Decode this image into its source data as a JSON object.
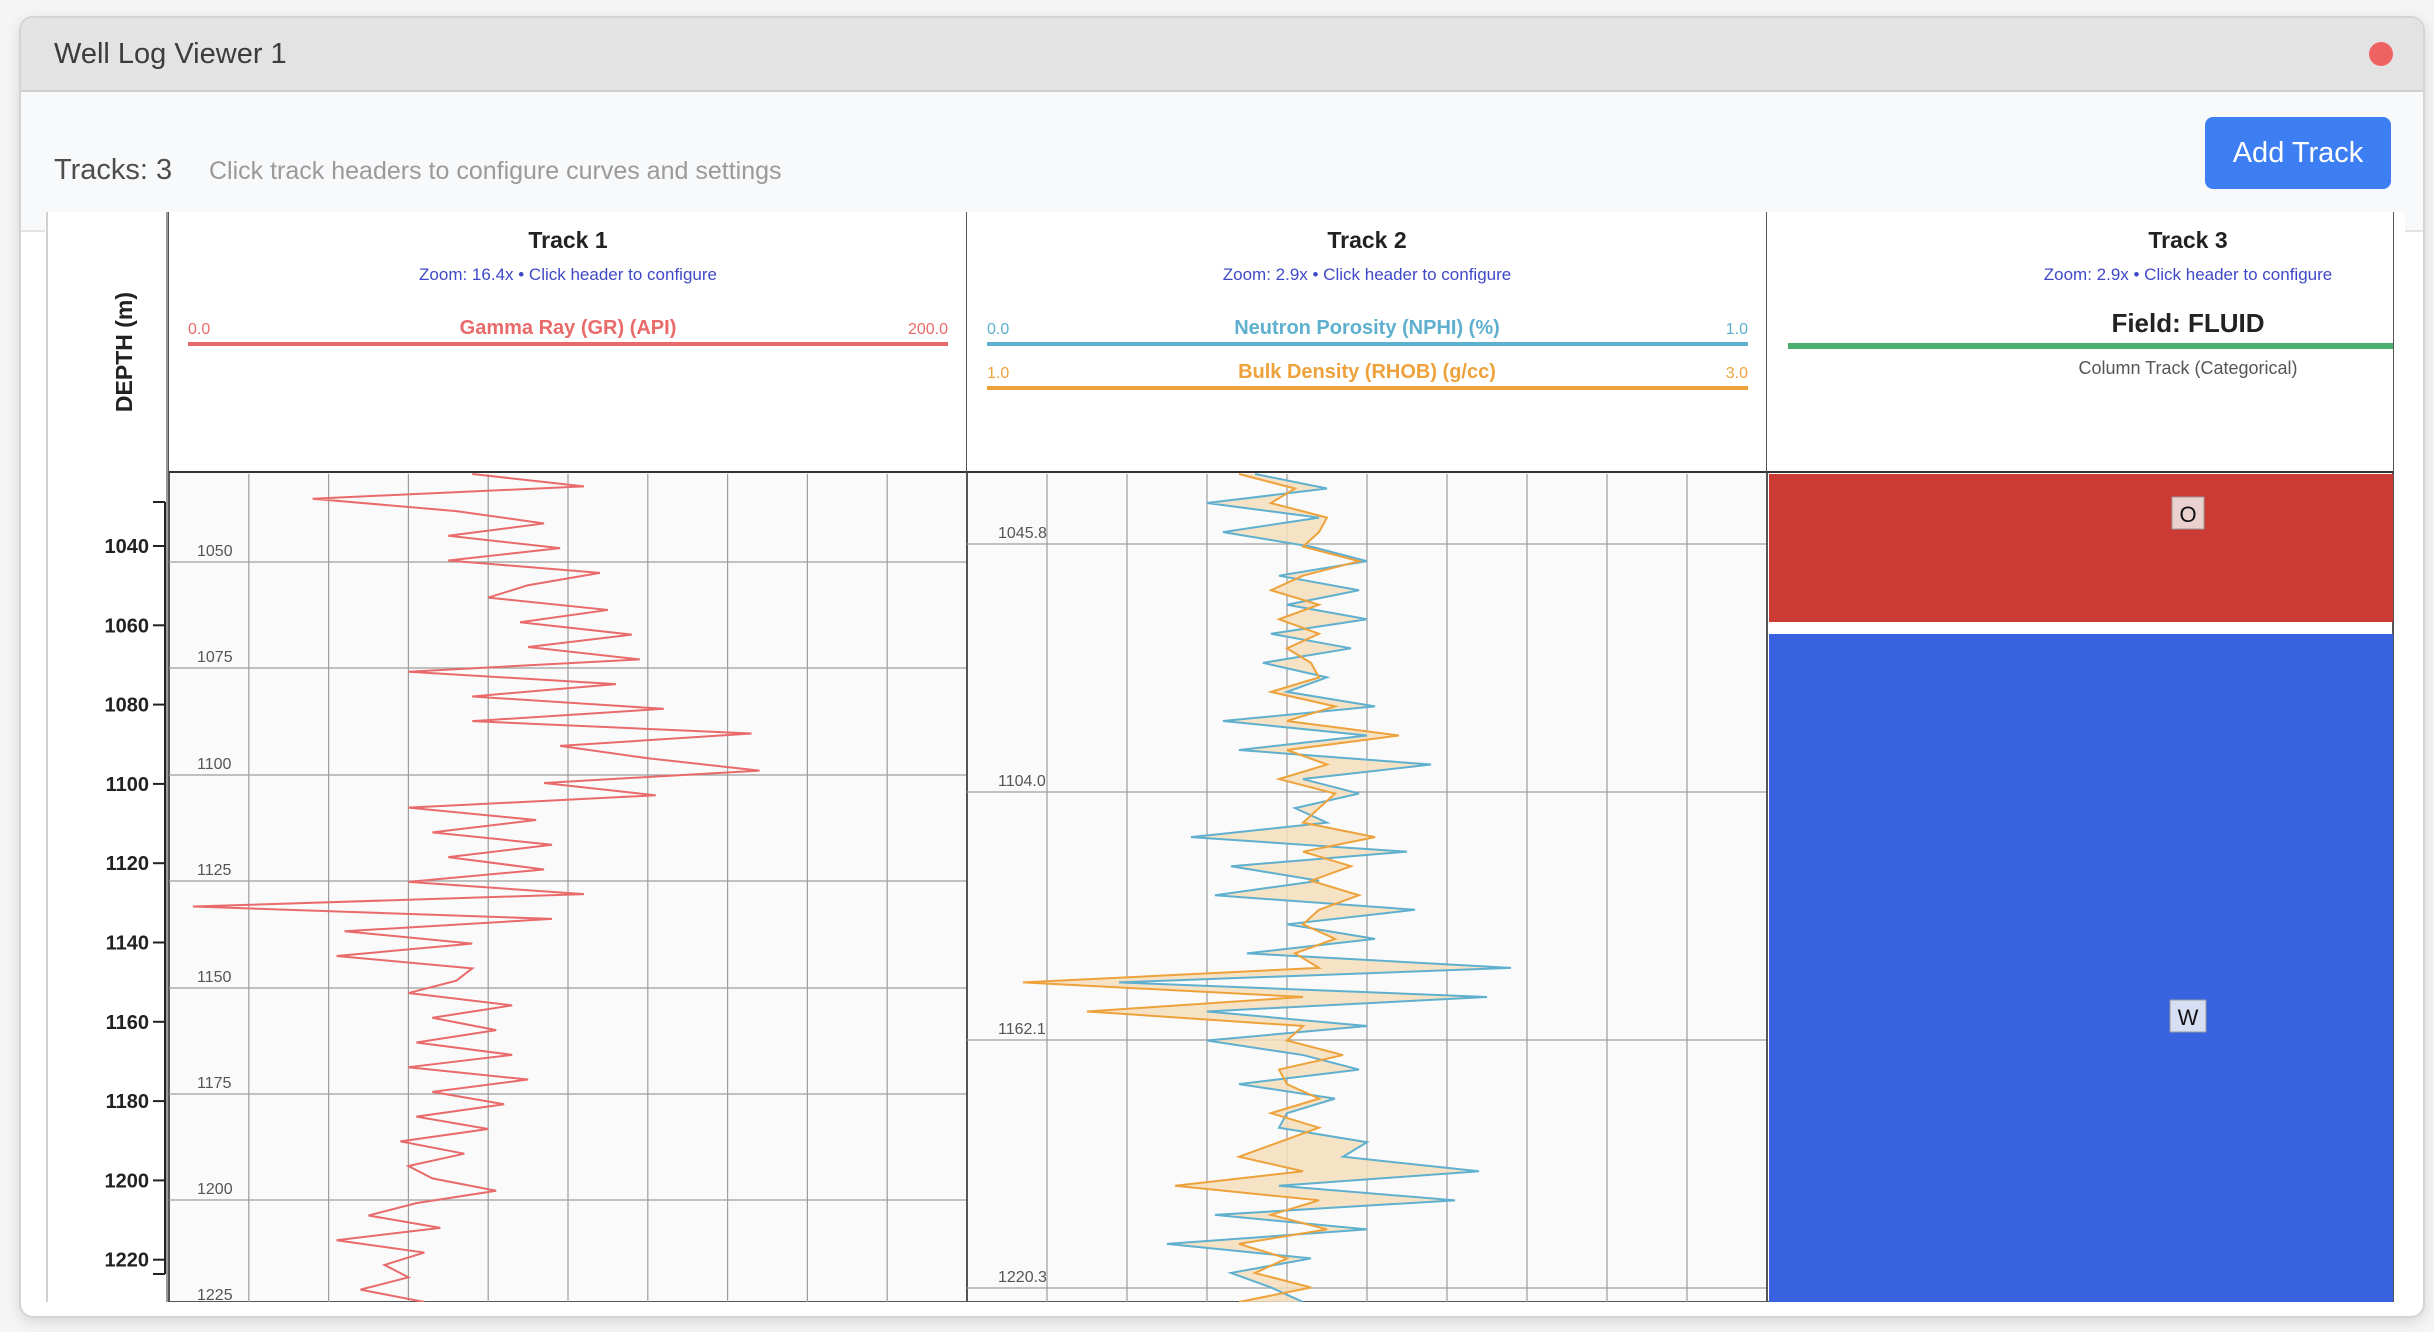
{
  "window": {
    "title": "Well Log Viewer 1",
    "close_color": "#ee6262"
  },
  "toolbar": {
    "tracks_label": "Tracks: 3",
    "hint": "Click track headers to configure curves and settings",
    "add_button": "Add Track",
    "accent": "#3d7ff2"
  },
  "depth_axis": {
    "label": "DEPTH (m)",
    "ticks": [
      "1040",
      "1060",
      "1080",
      "1100",
      "1120",
      "1140",
      "1160",
      "1180",
      "1200",
      "1220"
    ]
  },
  "tracks": [
    {
      "title": "Track 1",
      "subtitle": "Zoom: 16.4x • Click header to configure",
      "curves": [
        {
          "name": "Gamma Ray (GR) (API)",
          "min": "0.0",
          "max": "200.0",
          "color": "#e96a6a"
        }
      ],
      "depth_labels": [
        "1050",
        "1075",
        "1100",
        "1125",
        "1150",
        "1175",
        "1200",
        "1225"
      ]
    },
    {
      "title": "Track 2",
      "subtitle": "Zoom: 2.9x • Click header to configure",
      "curves": [
        {
          "name": "Neutron Porosity (NPHI) (%)",
          "min": "0.0",
          "max": "1.0",
          "color": "#5fb0cf"
        },
        {
          "name": "Bulk Density (RHOB) (g/cc)",
          "min": "1.0",
          "max": "3.0",
          "color": "#eda23b"
        }
      ],
      "fill_color": "#f5ddbb",
      "depth_labels": [
        "1045.8",
        "1104.0",
        "1162.1",
        "1220.3"
      ]
    },
    {
      "title": "Track 3",
      "subtitle": "Zoom: 2.9x • Click header to configure",
      "field": "Field: FLUID",
      "field_color": "#4caf6e",
      "caption": "Column Track (Categorical)",
      "zones": [
        {
          "code": "O",
          "color": "#cc3b33"
        },
        {
          "code": "W",
          "color": "#3962e0"
        }
      ]
    }
  ]
}
